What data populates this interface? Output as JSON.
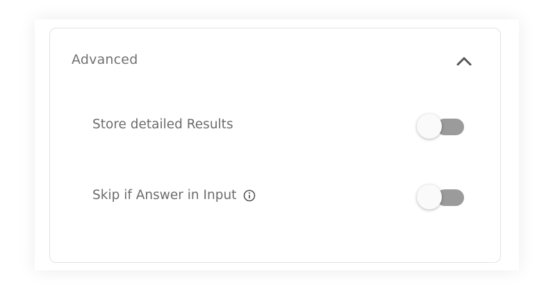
{
  "section": {
    "title": "Advanced",
    "expanded": true,
    "settings": [
      {
        "label": "Store detailed Results",
        "enabled": false,
        "has_info": false
      },
      {
        "label": "Skip if Answer in Input",
        "enabled": false,
        "has_info": true
      }
    ]
  },
  "colors": {
    "track_off": "#9b9b9b",
    "text": "#6b6b6b"
  }
}
